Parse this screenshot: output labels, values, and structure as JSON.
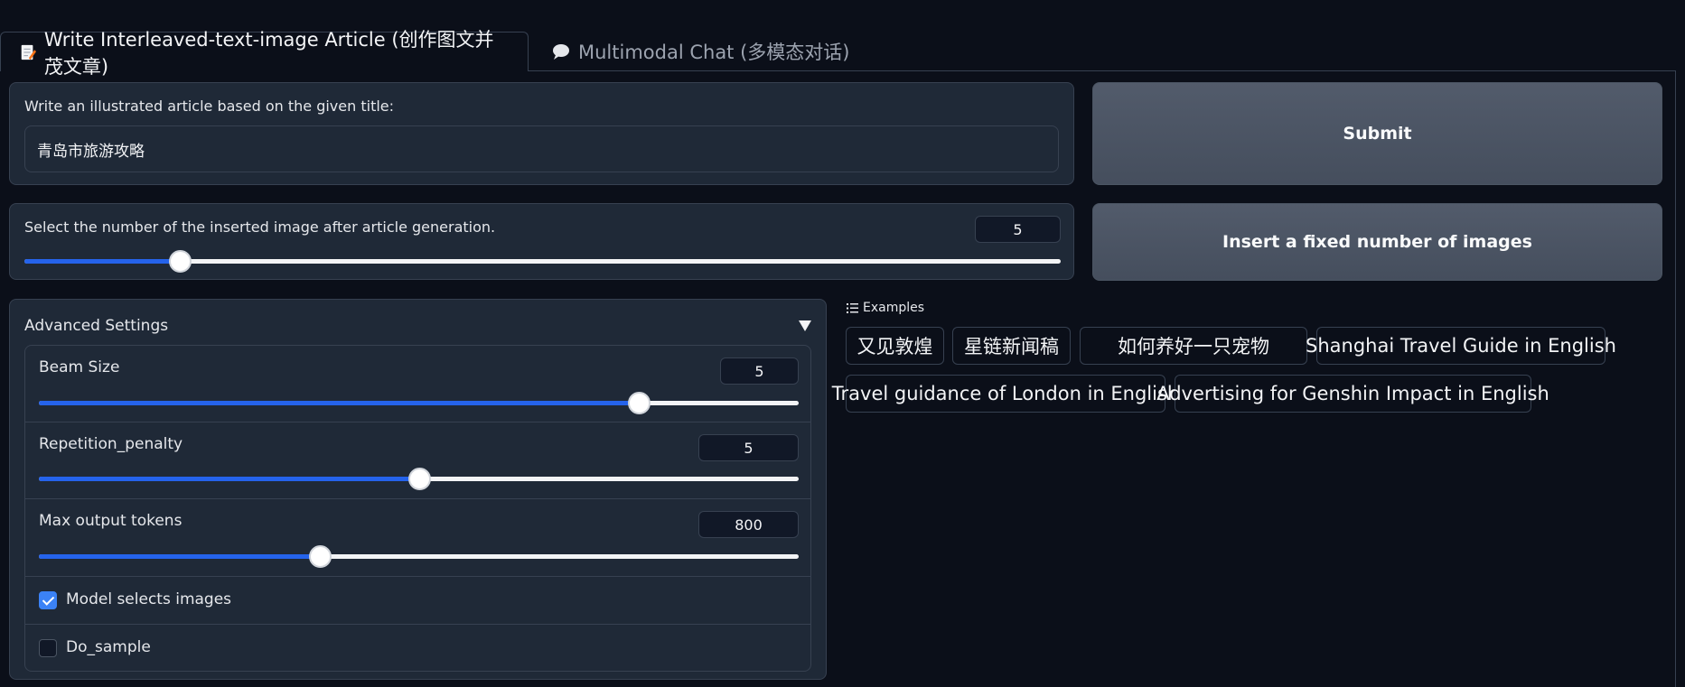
{
  "tabs": [
    {
      "label": "Write Interleaved-text-image Article (创作图文并茂文章)",
      "icon": "memo-icon",
      "active": true
    },
    {
      "label": "Multimodal Chat (多模态对话)",
      "icon": "speech-bubble-icon",
      "active": false
    }
  ],
  "title_input": {
    "label": "Write an illustrated article based on the given title:",
    "value": "青岛市旅游攻略"
  },
  "submit_button": "Submit",
  "image_count": {
    "label": "Select the number of the inserted image after article generation.",
    "value": "5",
    "fraction": 0.15
  },
  "insert_button": "Insert a fixed number of images",
  "advanced": {
    "title": "Advanced Settings",
    "beam_size": {
      "label": "Beam Size",
      "value": "5",
      "fraction": 0.79
    },
    "repetition_penalty": {
      "label": "Repetition_penalty",
      "value": "5",
      "fraction": 0.5
    },
    "max_output_tokens": {
      "label": "Max output tokens",
      "value": "800",
      "fraction": 0.37
    },
    "model_selects_images": {
      "label": "Model selects images",
      "checked": true
    },
    "do_sample": {
      "label": "Do_sample",
      "checked": false
    }
  },
  "examples": {
    "label": "Examples",
    "items": [
      "又见敦煌",
      "星链新闻稿",
      "如何养好一只宠物",
      "Shanghai Travel Guide in English",
      "Travel guidance of London in English",
      "Advertising for Genshin Impact in English"
    ]
  },
  "colors": {
    "background": "#0b0f19",
    "panel": "#1f2937",
    "border": "#374151",
    "accent": "#2563eb",
    "button": "#4b5563"
  }
}
